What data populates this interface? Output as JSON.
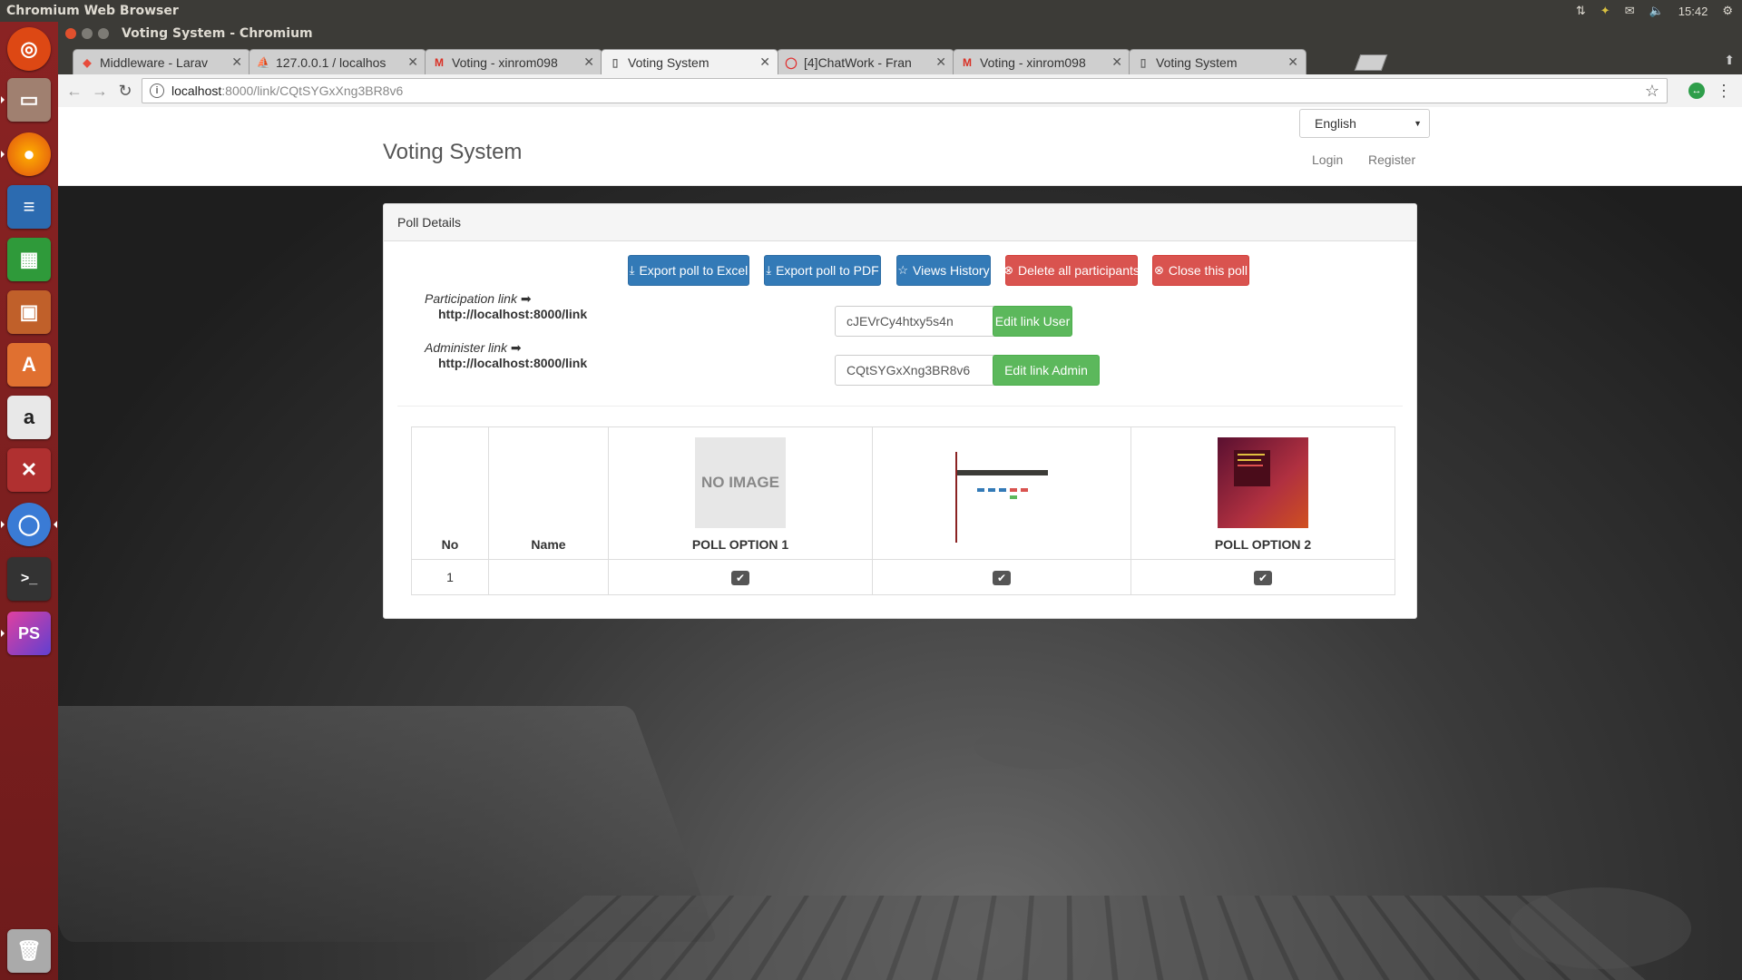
{
  "system": {
    "app_name": "Chromium Web Browser",
    "clock": "15:42"
  },
  "window": {
    "title": "Voting System - Chromium"
  },
  "tabs": [
    {
      "label": "Middleware - Larav",
      "favicon": "laravel-icon",
      "color": "#e74c3c"
    },
    {
      "label": "127.0.0.1 / localhos",
      "favicon": "phpmyadmin-icon",
      "color": "#e0a030"
    },
    {
      "label": "Voting - xinrom098",
      "favicon": "gmail-icon",
      "color": "#d93025"
    },
    {
      "label": "Voting System",
      "favicon": "page-icon",
      "color": "#666666"
    },
    {
      "label": "[4]ChatWork - Fran",
      "favicon": "chatwork-icon",
      "color": "#e03030"
    },
    {
      "label": "Voting - xinrom098",
      "favicon": "gmail-icon",
      "color": "#d93025"
    },
    {
      "label": "Voting System",
      "favicon": "page-icon",
      "color": "#666666"
    }
  ],
  "address_bar": {
    "host": "localhost",
    "path": ":8000/link/CQtSYGxXng3BR8v6"
  },
  "site": {
    "brand": "Voting System",
    "language": "English",
    "login": "Login",
    "register": "Register"
  },
  "panel": {
    "heading": "Poll Details",
    "buttons": {
      "export_excel": "Export poll to Excel",
      "export_pdf": "Export poll to PDF",
      "views_history": "Views History",
      "delete_participants": "Delete all participants",
      "close_poll": "Close this poll"
    },
    "participation": {
      "label": "Participation link",
      "url": "http://localhost:8000/link",
      "token": "cJEVrCy4htxy5s4n",
      "edit_button": "Edit link User"
    },
    "administer": {
      "label": "Administer link",
      "url": "http://localhost:8000/link",
      "token": "CQtSYGxXng3BR8v6",
      "edit_button": "Edit link Admin"
    },
    "table": {
      "headers": {
        "no": "No",
        "name": "Name",
        "option1": "POLL OPTION 1",
        "option1_image": "NO IMAGE",
        "option_blank": "",
        "option2": "POLL OPTION 2"
      },
      "rows": [
        {
          "no": "1",
          "name": ""
        }
      ]
    }
  },
  "colors": {
    "primary": "#337ab7",
    "danger": "#d9534f",
    "success": "#5cb85c",
    "launcher": "#7d1f1f"
  }
}
